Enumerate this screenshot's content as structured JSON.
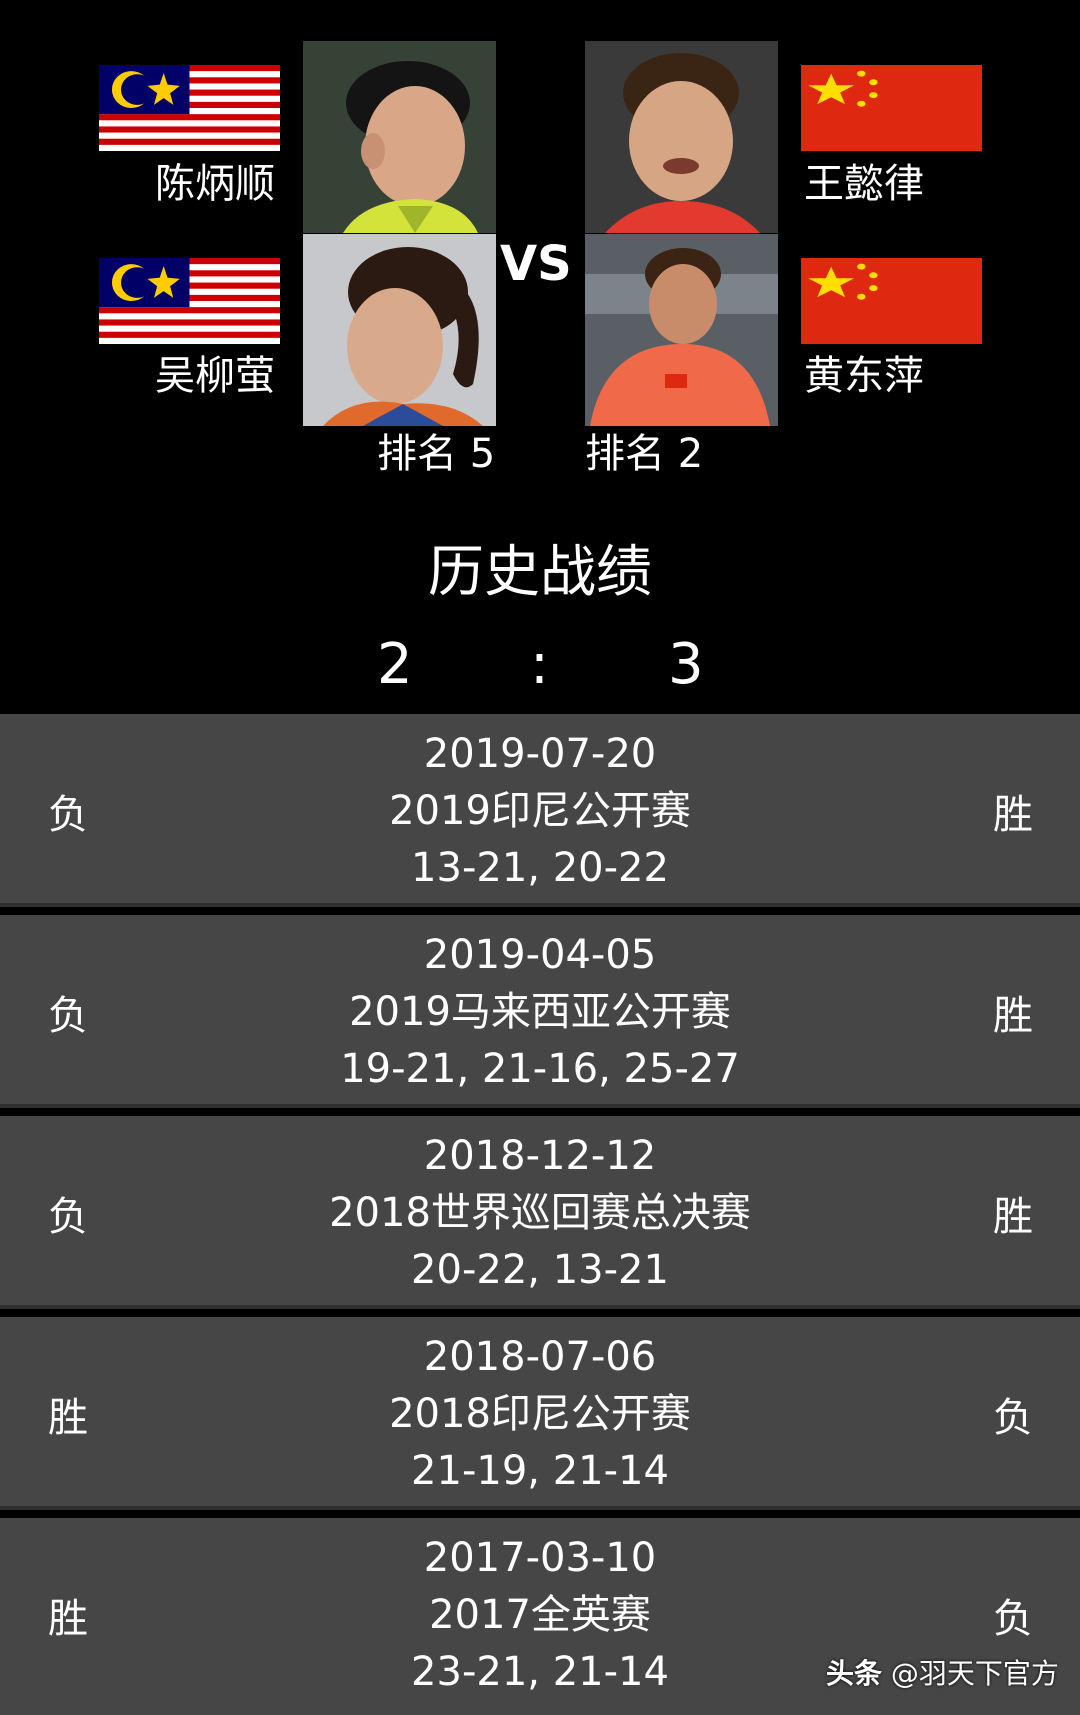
{
  "left_team": {
    "players": [
      {
        "name": "陈炳顺",
        "flag": "malaysia-flag",
        "photo": "male-player-photo"
      },
      {
        "name": "吴柳萤",
        "flag": "malaysia-flag",
        "photo": "female-player-photo"
      }
    ],
    "rank": "排名 5"
  },
  "vs_label": "VS",
  "right_team": {
    "players": [
      {
        "name": "王懿律",
        "flag": "china-flag",
        "photo": "male-player-photo"
      },
      {
        "name": "黄东萍",
        "flag": "china-flag",
        "photo": "female-player-photo"
      }
    ],
    "rank": "排名 2"
  },
  "history": {
    "title": "历史战绩",
    "score_left": "2",
    "separator": ":",
    "score_right": "3"
  },
  "matches": [
    {
      "date": "2019-07-20",
      "event": "2019印尼公开赛",
      "score": "13-21, 20-22",
      "left_result": "负",
      "right_result": "胜"
    },
    {
      "date": "2019-04-05",
      "event": "2019马来西亚公开赛",
      "score": "19-21, 21-16, 25-27",
      "left_result": "负",
      "right_result": "胜"
    },
    {
      "date": "2018-12-12",
      "event": "2018世界巡回赛总决赛",
      "score": "20-22, 13-21",
      "left_result": "负",
      "right_result": "胜"
    },
    {
      "date": "2018-07-06",
      "event": "2018印尼公开赛",
      "score": "21-19, 21-14",
      "left_result": "胜",
      "right_result": "负"
    },
    {
      "date": "2017-03-10",
      "event": "2017全英赛",
      "score": "23-21, 21-14",
      "left_result": "胜",
      "right_result": "负"
    }
  ],
  "watermark": {
    "brand": "头条",
    "handle": "@羽天下官方"
  },
  "colors": {
    "background": "#000000",
    "row_background": "#464646",
    "row_divider": "#2f2f2f",
    "malaysia_red": "#cc0001",
    "malaysia_blue": "#010066",
    "malaysia_yellow": "#ffcc00",
    "china_red": "#de2910",
    "china_yellow": "#ffde00"
  }
}
